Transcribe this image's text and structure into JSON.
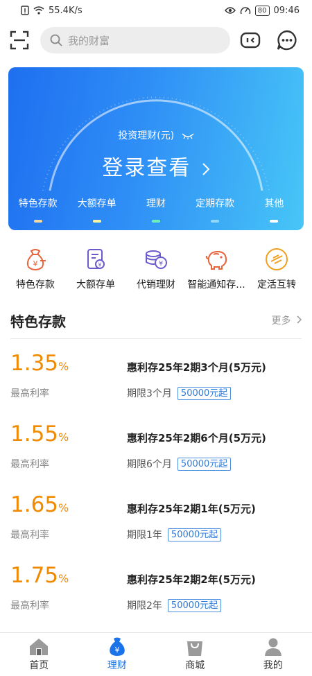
{
  "status_bar": {
    "speed": "55.4K/s",
    "battery": "80",
    "time": "09:46"
  },
  "header": {
    "search_placeholder": "我的财富"
  },
  "banner": {
    "subtitle": "投资理财(元)",
    "login_text": "登录查看",
    "tabs": [
      {
        "label": "特色存款",
        "dash_color": "#f3d7a0"
      },
      {
        "label": "大额存单",
        "dash_color": "#f9f3a3"
      },
      {
        "label": "理财",
        "dash_color": "#6ff0b8"
      },
      {
        "label": "定期存款",
        "dash_color": "#8fd8ff"
      },
      {
        "label": "其他",
        "dash_color": "#ffffff"
      }
    ]
  },
  "quick_menu": [
    {
      "label": "特色存款",
      "icon": "money-bag-icon"
    },
    {
      "label": "大额存单",
      "icon": "certificate-icon"
    },
    {
      "label": "代销理财",
      "icon": "coins-icon"
    },
    {
      "label": "智能通知存...",
      "icon": "piggy-bank-icon"
    },
    {
      "label": "定活互转",
      "icon": "exchange-icon"
    }
  ],
  "section": {
    "title": "特色存款",
    "more": "更多"
  },
  "products": [
    {
      "rate": "1.35",
      "unit": "%",
      "rate_label": "最高利率",
      "name": "惠利存25年2期3个月(5万元)",
      "term": "期限3个月",
      "min": "50000元起"
    },
    {
      "rate": "1.55",
      "unit": "%",
      "rate_label": "最高利率",
      "name": "惠利存25年2期6个月(5万元)",
      "term": "期限6个月",
      "min": "50000元起"
    },
    {
      "rate": "1.65",
      "unit": "%",
      "rate_label": "最高利率",
      "name": "惠利存25年2期1年(5万元)",
      "term": "期限1年",
      "min": "50000元起"
    },
    {
      "rate": "1.75",
      "unit": "%",
      "rate_label": "最高利率",
      "name": "惠利存25年2期2年(5万元)",
      "term": "期限2年",
      "min": "50000元起"
    }
  ],
  "bottom_nav": [
    {
      "label": "首页",
      "icon": "home-icon"
    },
    {
      "label": "理财",
      "icon": "wealth-icon",
      "active": true
    },
    {
      "label": "商城",
      "icon": "shop-bag-icon"
    },
    {
      "label": "我的",
      "icon": "user-icon"
    }
  ],
  "colors": {
    "accent": "#1a73e8",
    "rate": "#f08a00",
    "banner_start": "#1e6ff0",
    "banner_end": "#48c6f7"
  }
}
